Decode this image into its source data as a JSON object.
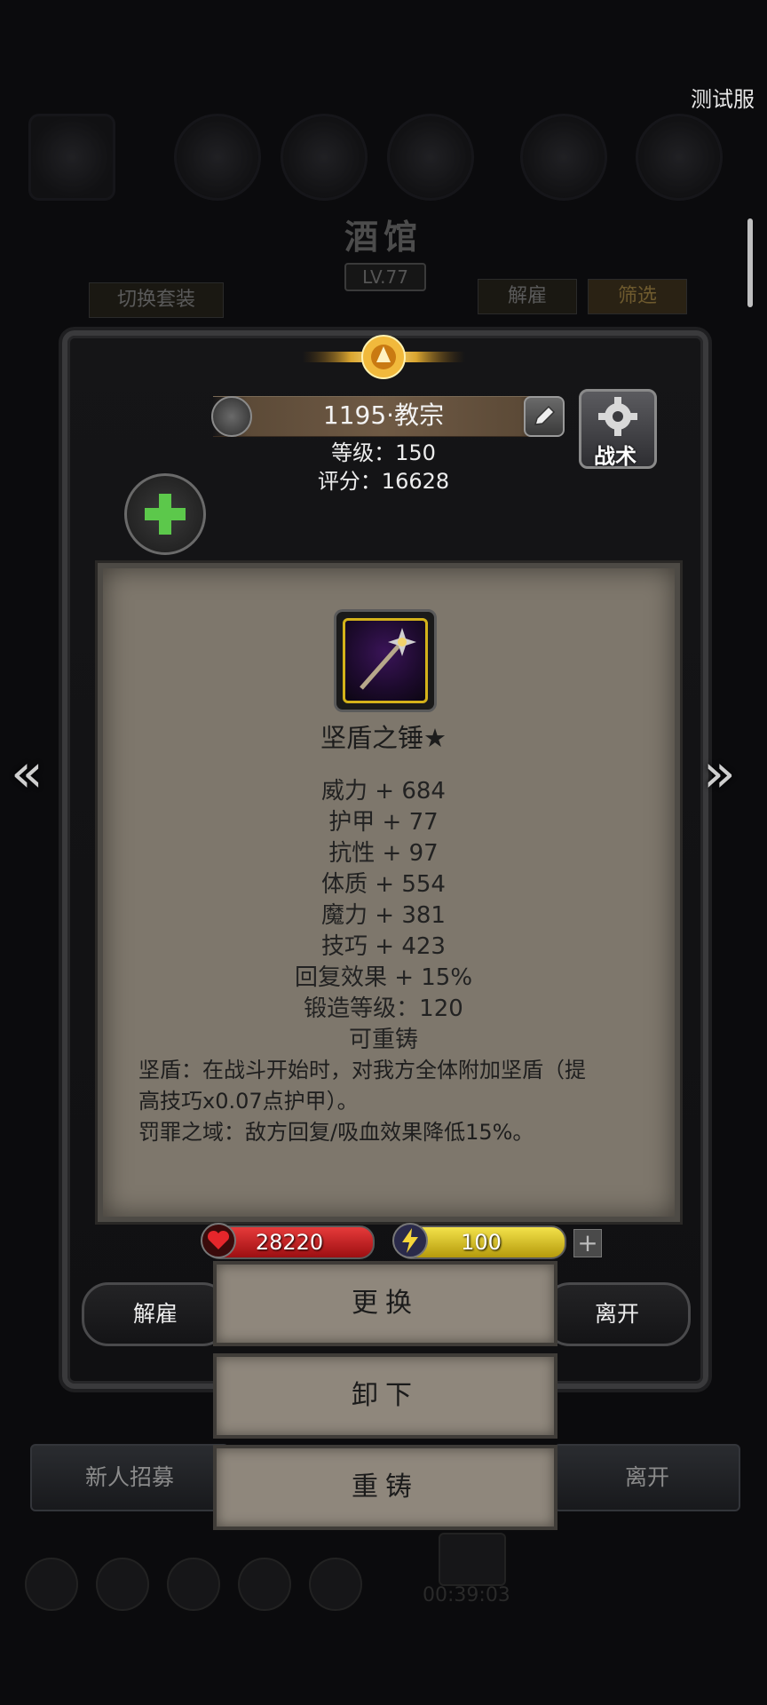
{
  "server_tag": "测试服",
  "background": {
    "title": "酒馆",
    "level": "LV.77",
    "switch_set_label": "切换套装",
    "dismiss_label": "解雇",
    "filter_label": "筛选",
    "recruit_label": "新人招募",
    "leave_label": "离开",
    "timer": "00:39:03"
  },
  "hero": {
    "name": "1195·教宗",
    "level_line": "等级：150",
    "score_line": "评分：16628",
    "tactics_label": "战术"
  },
  "item": {
    "name": "坚盾之锤★",
    "stats": [
      "威力 + 684",
      "护甲 + 77",
      "抗性 + 97",
      "体质 + 554",
      "魔力 + 381",
      "技巧 + 423",
      "回复效果 + 15%",
      "锻造等级：120",
      "可重铸"
    ],
    "description": [
      "坚盾：在战斗开始时，对我方全体附加坚盾（提",
      "高技巧x0.07点护甲）。",
      "罚罪之域：敌方回复/吸血效果降低15%。"
    ]
  },
  "resources": {
    "hp": "28220",
    "energy": "100",
    "plus": "+"
  },
  "buttons": {
    "dismiss": "解雇",
    "leave": "离开",
    "replace": "更换",
    "unequip": "卸下",
    "reforge": "重铸"
  },
  "nav": {
    "prev": "«",
    "next": "»"
  },
  "colors": {
    "panel": "#7e776c",
    "accent_gold": "#d4b21a",
    "hp_red": "#c8161b",
    "energy_yellow": "#e6cf27"
  }
}
